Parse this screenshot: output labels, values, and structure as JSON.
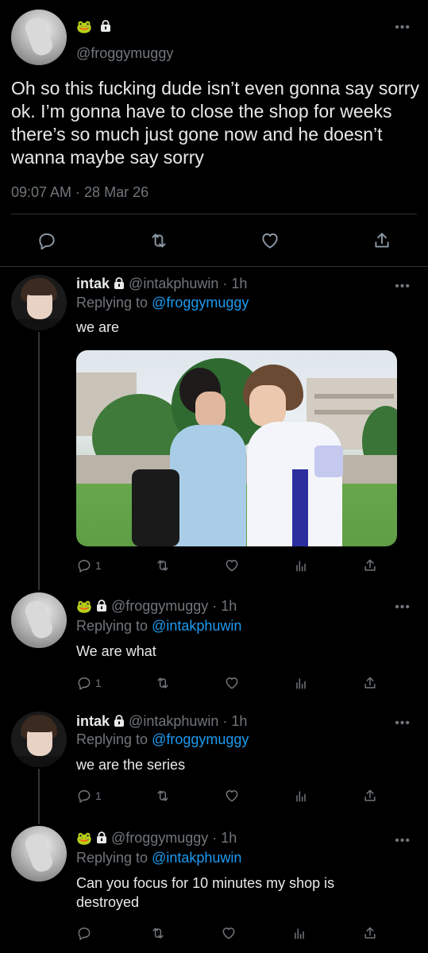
{
  "main_tweet": {
    "emoji": "🐸",
    "handle": "@froggymuggy",
    "text": "Oh so this fucking dude isn’t even gonna say sorry ok. I’m gonna have to close the shop for weeks there’s so much just gone now and he doesn’t wanna maybe say sorry",
    "timestamp": "09:07 AM · 28 Mar 26"
  },
  "replies": [
    {
      "name": "intak",
      "handle": "@intakphuwin",
      "time": "· 1h",
      "replying_prefix": "Replying to",
      "replying_to": "@froggymuggy",
      "text": "we are",
      "reply_count": "1"
    },
    {
      "emoji": "🐸",
      "handle": "@froggymuggy",
      "time": "· 1h",
      "replying_prefix": "Replying to",
      "replying_to": "@intakphuwin",
      "text": "We are what",
      "reply_count": "1"
    },
    {
      "name": "intak",
      "handle": "@intakphuwin",
      "time": "· 1h",
      "replying_prefix": "Replying to",
      "replying_to": "@froggymuggy",
      "text": "we are the series",
      "reply_count": "1"
    },
    {
      "emoji": "🐸",
      "handle": "@froggymuggy",
      "time": "· 1h",
      "replying_prefix": "Replying to",
      "replying_to": "@intakphuwin",
      "text": "Can you focus for 10 minutes my shop is destroyed",
      "reply_count": ""
    }
  ],
  "colors": {
    "background": "#000000",
    "link": "#1d9bf0",
    "muted": "#71767b",
    "divider": "#2f3336"
  },
  "icons": [
    "reply-icon",
    "retweet-icon",
    "like-icon",
    "share-icon",
    "analytics-icon",
    "lock-icon",
    "more-icon"
  ]
}
